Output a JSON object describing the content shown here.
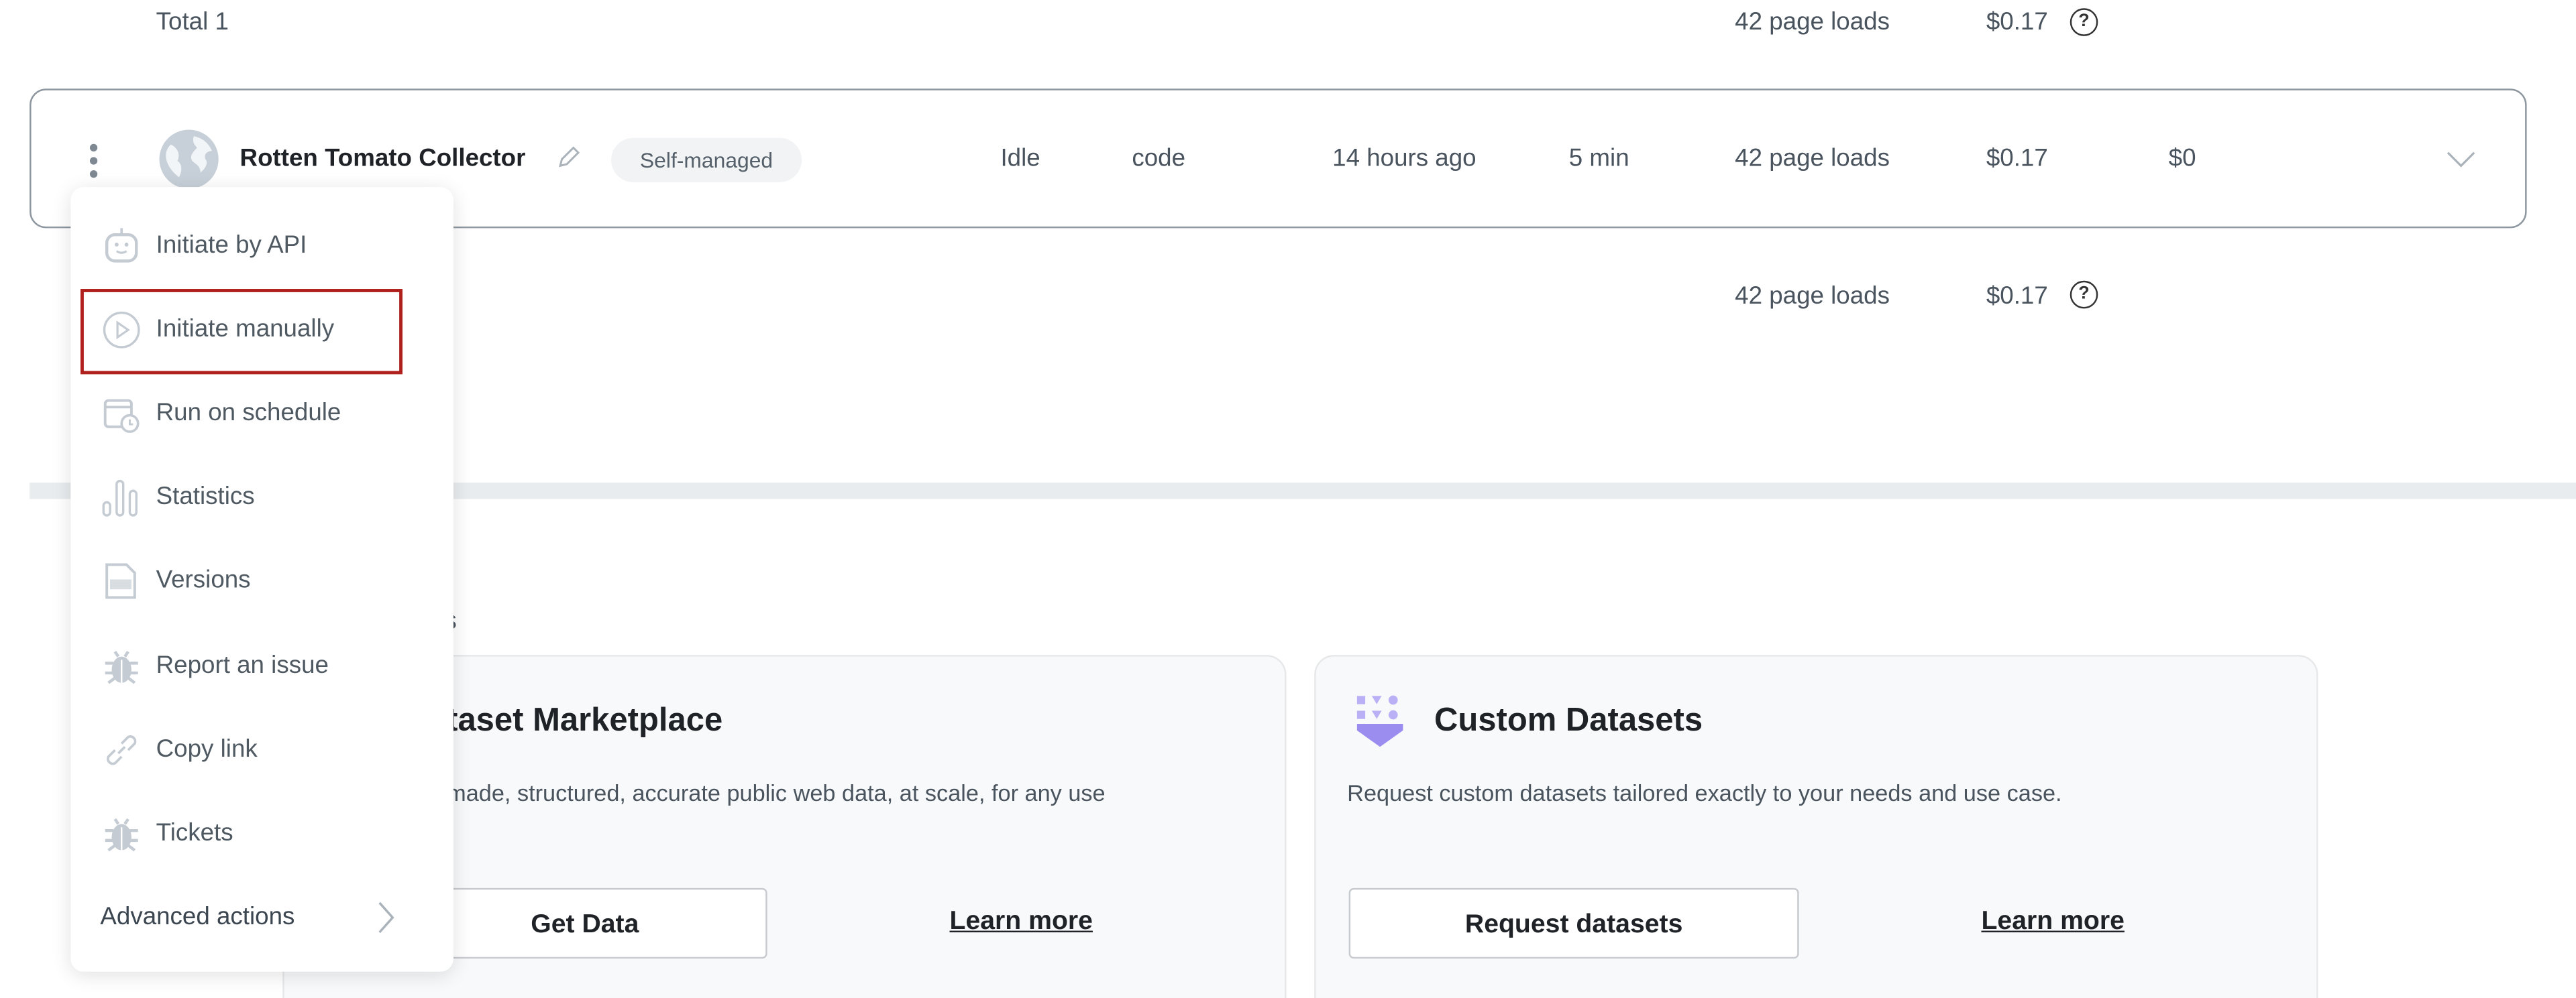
{
  "summary_top": {
    "label": "Total 1",
    "page_loads": "42 page loads",
    "cost": "$0.17"
  },
  "collector_row": {
    "name": "Rotten Tomato Collector",
    "badge": "Self-managed",
    "status": "Idle",
    "type": "code",
    "last_run": "14 hours ago",
    "duration": "5 min",
    "page_loads": "42 page loads",
    "cost": "$0.17",
    "extra_cost": "$0"
  },
  "summary_bottom": {
    "page_loads": "42 page loads",
    "cost": "$0.17"
  },
  "section_label_fragment": "s",
  "cards": [
    {
      "title": "taset Marketplace",
      "description": "made, structured, accurate public web data, at scale, for any use",
      "button": "Get Data",
      "link": "Learn more"
    },
    {
      "title": "Custom Datasets",
      "description": "Request custom datasets tailored exactly to your needs and use case.",
      "button": "Request datasets",
      "link": "Learn more",
      "icon": "custom-datasets-icon",
      "icon_color": "#9b8df0"
    }
  ],
  "menu": {
    "items": [
      {
        "label": "Initiate by API",
        "icon": "robot-icon"
      },
      {
        "label": "Initiate manually",
        "icon": "play-circle-icon",
        "highlighted": true
      },
      {
        "label": "Run on schedule",
        "icon": "calendar-clock-icon"
      },
      {
        "label": "Statistics",
        "icon": "bar-chart-icon"
      },
      {
        "label": "Versions",
        "icon": "log-file-icon"
      },
      {
        "label": "Report an issue",
        "icon": "bug-icon"
      },
      {
        "label": "Copy link",
        "icon": "link-icon"
      },
      {
        "label": "Tickets",
        "icon": "bug-icon"
      }
    ],
    "advanced": "Advanced actions"
  },
  "colors": {
    "highlight": "#b0201c",
    "icon_gray": "#c4cbd2",
    "divider": "#e9ecee"
  }
}
